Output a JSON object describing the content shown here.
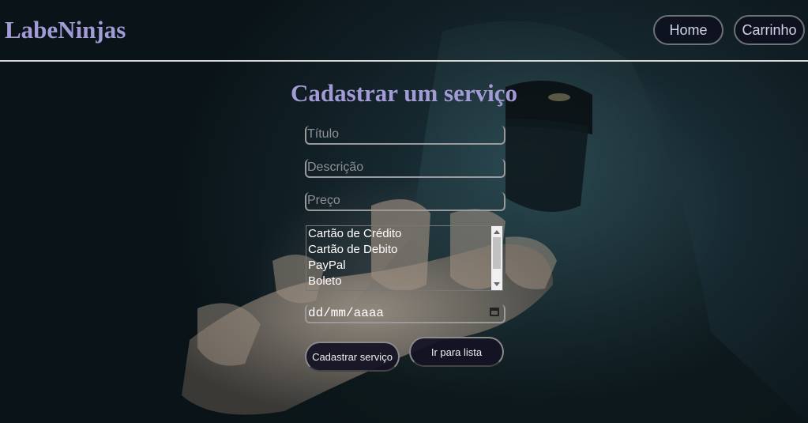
{
  "header": {
    "logo": "LabeNinjas",
    "nav": {
      "home": "Home",
      "cart": "Carrinho"
    }
  },
  "form": {
    "title": "Cadastrar um serviço",
    "titulo_placeholder": "Título",
    "descricao_placeholder": "Descrição",
    "preco_placeholder": "Preço",
    "payment_options": [
      "Cartão de Crédito",
      "Cartão de Debito",
      "PayPal",
      "Boleto"
    ],
    "date_placeholder": "dd/mm/aaaa",
    "submit_label": "Cadastrar serviço",
    "list_label": "Ir para lista"
  },
  "icons": {
    "date": "calendar-icon"
  },
  "colors": {
    "accent": "#a39bd6",
    "button_bg": "#14122a"
  }
}
